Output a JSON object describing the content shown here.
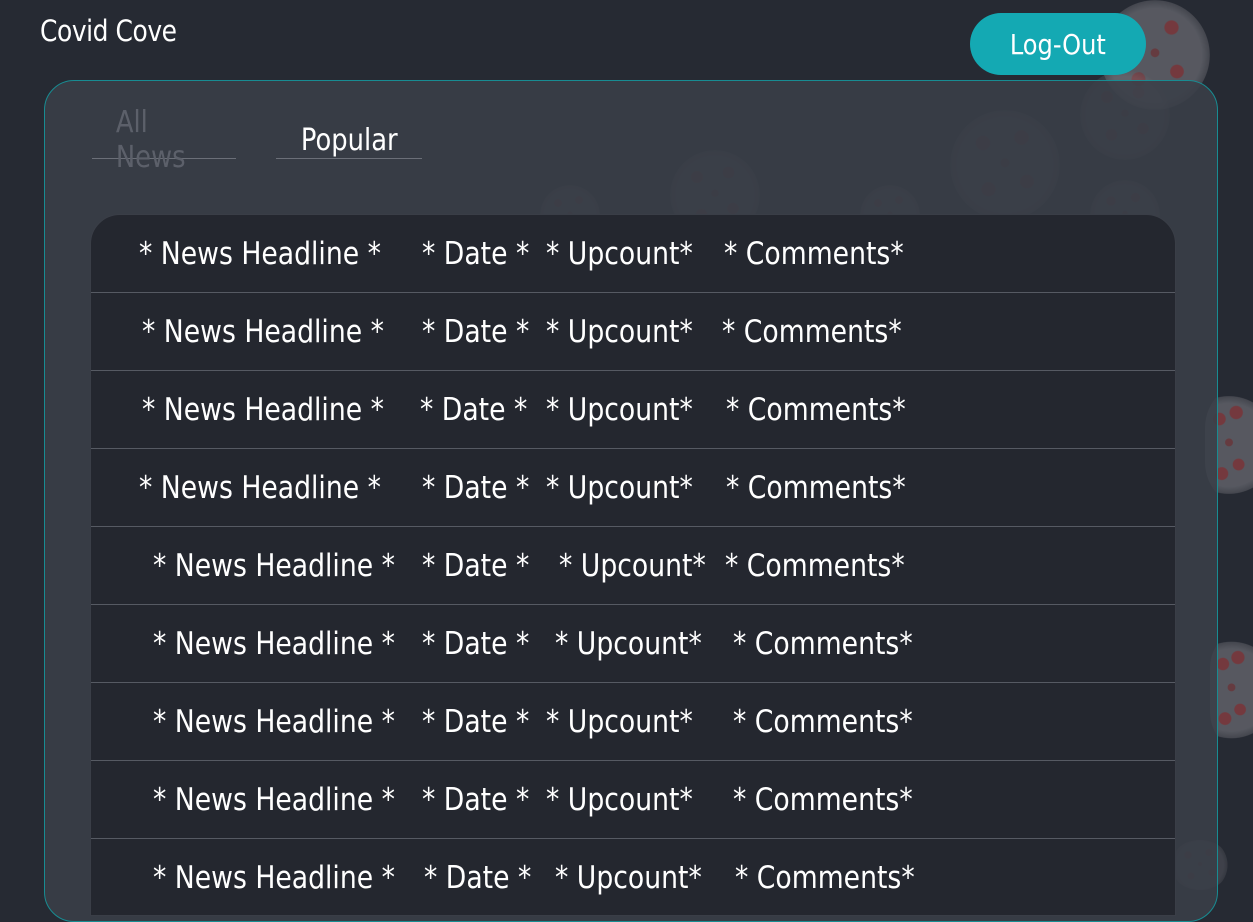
{
  "header": {
    "app_title": "Covid Cove",
    "logout_label": "Log-Out"
  },
  "tabs": [
    {
      "label": "All News",
      "active": false
    },
    {
      "label": "Popular",
      "active": true
    }
  ],
  "news_rows": [
    {
      "headline": "* News Headline *",
      "date": "* Date *",
      "upcount": "* Upcount*",
      "comments": "* Comments*"
    },
    {
      "headline": "* News Headline *",
      "date": "* Date *",
      "upcount": "* Upcount*",
      "comments": "* Comments*"
    },
    {
      "headline": "* News Headline *",
      "date": "* Date *",
      "upcount": "* Upcount*",
      "comments": "* Comments*"
    },
    {
      "headline": "* News Headline *",
      "date": "* Date *",
      "upcount": "* Upcount*",
      "comments": "* Comments*"
    },
    {
      "headline": "* News Headline *",
      "date": "* Date *",
      "upcount": "* Upcount*",
      "comments": "* Comments*"
    },
    {
      "headline": "* News Headline *",
      "date": "* Date *",
      "upcount": "* Upcount*",
      "comments": "* Comments*"
    },
    {
      "headline": "* News Headline *",
      "date": "* Date *",
      "upcount": "* Upcount*",
      "comments": "* Comments*"
    },
    {
      "headline": "* News Headline *",
      "date": "* Date *",
      "upcount": "* Upcount*",
      "comments": "* Comments*"
    },
    {
      "headline": "* News Headline *",
      "date": "* Date *",
      "upcount": "* Upcount*",
      "comments": "* Comments*"
    }
  ],
  "colors": {
    "background": "#262a33",
    "accent": "#14a9b3",
    "panel_border": "#188c92",
    "inactive_tab": "#5c606a"
  },
  "decorations": {
    "background_icon": "virus-particle-icon"
  }
}
